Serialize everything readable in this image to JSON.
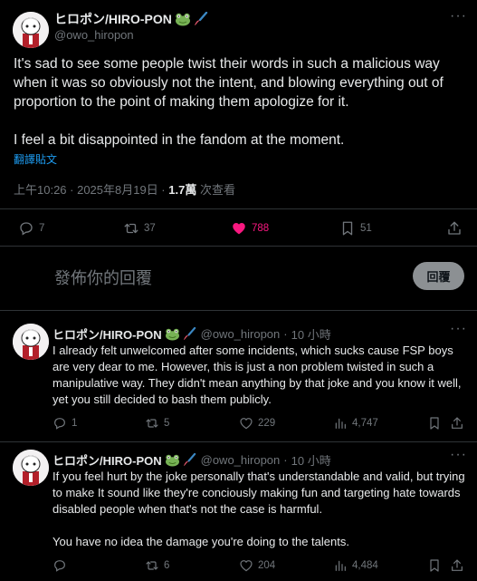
{
  "author": {
    "name": "ヒロポン/HIRO-PON",
    "handle": "@owo_hiropon",
    "emojis": [
      "frog-emoji",
      "paintbrush-emoji"
    ]
  },
  "main_tweet": {
    "paragraphs": [
      "It's sad to see some people twist their words in such a malicious way when it was so obviously not the intent, and blowing everything out of proportion to the point of making them apologize for it.",
      "I feel a bit disappointed in the fandom at the moment."
    ],
    "translate_label": "翻譯貼文",
    "time": "上午10:26 · 2025年8月19日 · ",
    "views_count": "1.7萬",
    "views_label": " 次查看",
    "stats": {
      "replies": "7",
      "retweets": "37",
      "likes": "788",
      "bookmarks": "51"
    }
  },
  "compose": {
    "placeholder": "發佈你的回覆",
    "button_label": "回覆"
  },
  "replies": [
    {
      "time": "10 小時",
      "paragraphs": [
        "I already felt unwelcomed after some incidents, which sucks cause FSP boys are very dear to me. However, this is just a non problem twisted in such a manipulative way. They didn't mean anything by that joke and you know it well, yet you still decided to bash them publicly."
      ],
      "stats": {
        "replies": "1",
        "retweets": "5",
        "likes": "229",
        "views": "4,747"
      }
    },
    {
      "time": "10 小時",
      "paragraphs": [
        "If you feel hurt by the joke personally that's understandable and valid, but trying to make It sound like they're conciously making fun and targeting hate towards disabled people when that's not the case is harmful.",
        "You have no idea the damage you're doing to the talents."
      ],
      "stats": {
        "replies": "",
        "retweets": "6",
        "likes": "204",
        "views": "4,484"
      }
    }
  ],
  "colors": {
    "background": "#000000",
    "text": "#e7e9ea",
    "muted": "#71767b",
    "link": "#1d9bf0",
    "like_active": "#f91880",
    "divider": "#2f3336"
  }
}
